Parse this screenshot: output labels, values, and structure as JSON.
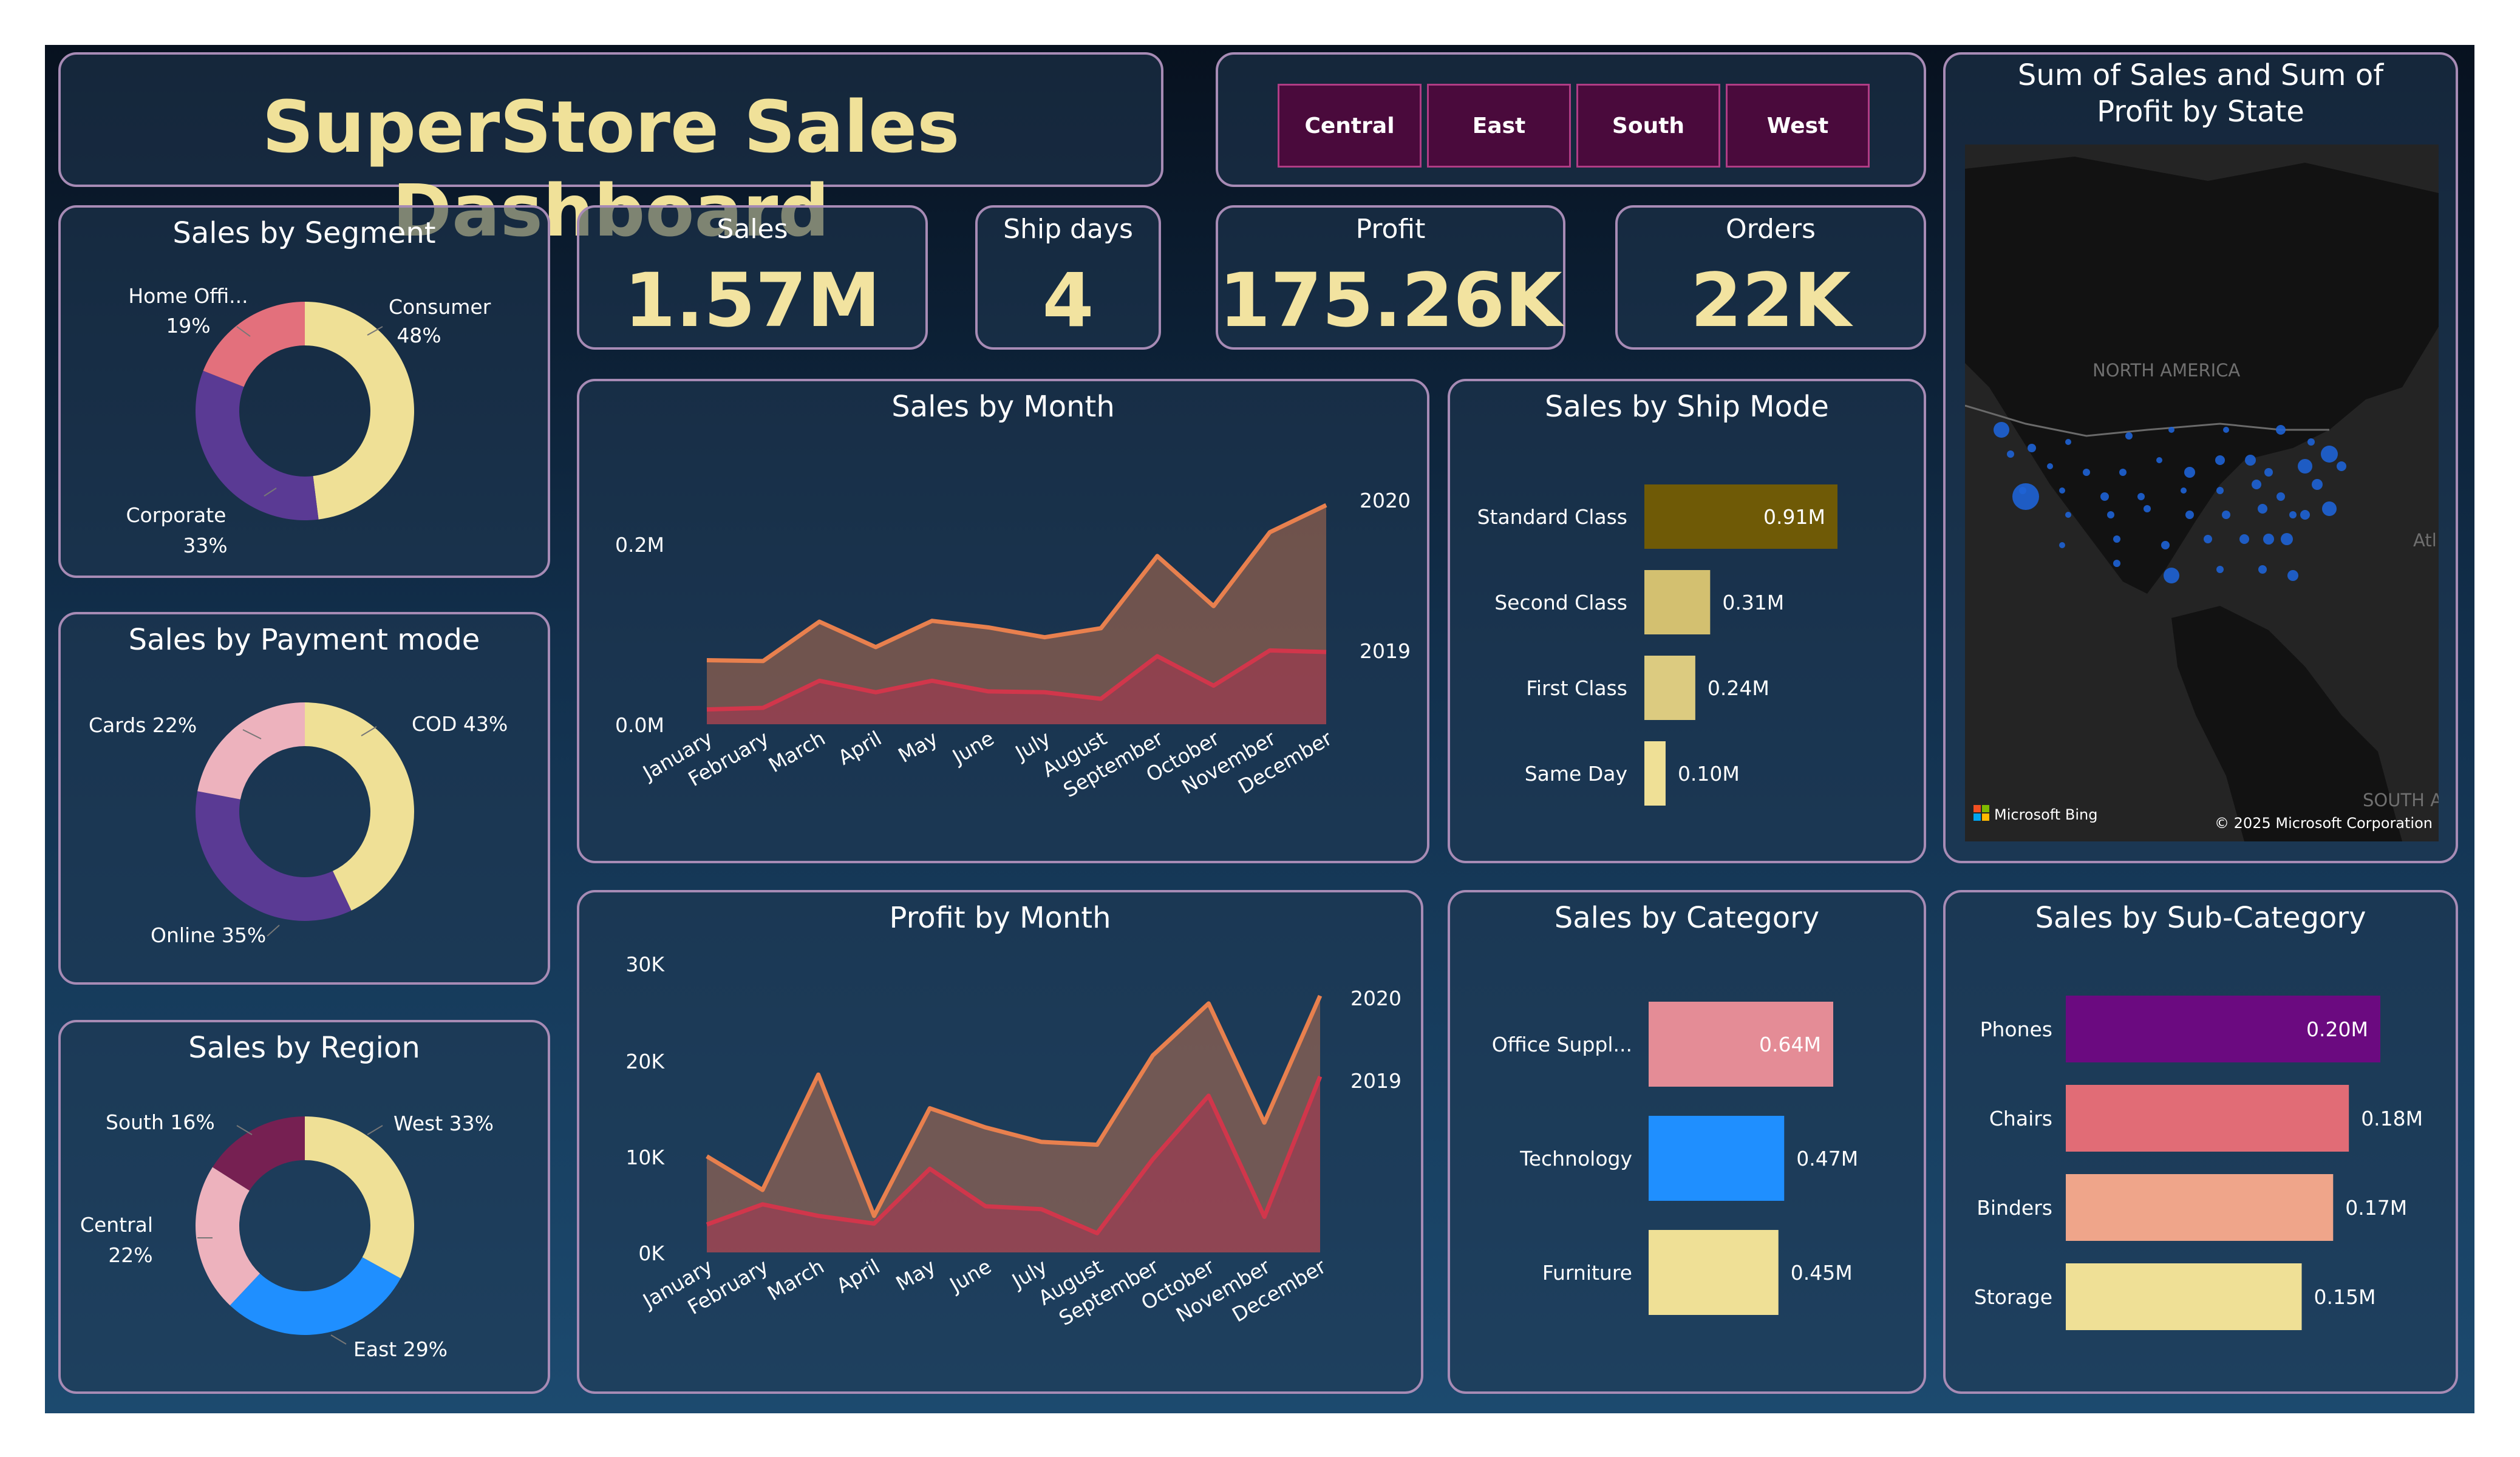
{
  "title": "SuperStore Sales Dashboard",
  "slicers": [
    "Central",
    "East",
    "South",
    "West"
  ],
  "kpis": {
    "sales": {
      "label": "Sales",
      "value": "1.57M"
    },
    "ship_days": {
      "label": "Ship days",
      "value": "4"
    },
    "profit": {
      "label": "Profit",
      "value": "175.26K"
    },
    "orders": {
      "label": "Orders",
      "value": "22K"
    }
  },
  "segment": {
    "title": "Sales by Segment",
    "labels": {
      "home_office": "Home Offi...",
      "home_office_pct": "19%",
      "consumer": "Consumer",
      "consumer_pct": "48%",
      "corporate": "Corporate",
      "corporate_pct": "33%"
    },
    "chart_data": {
      "type": "pie",
      "slices": [
        {
          "name": "Consumer",
          "value": 48,
          "color": "#efe096"
        },
        {
          "name": "Corporate",
          "value": 33,
          "color": "#5a3a94"
        },
        {
          "name": "Home Office",
          "value": 19,
          "color": "#e3707c"
        }
      ]
    }
  },
  "payment": {
    "title": "Sales by Payment mode",
    "labels": {
      "cod": "COD 43%",
      "online": "Online 35%",
      "cards": "Cards 22%"
    },
    "chart_data": {
      "type": "pie",
      "slices": [
        {
          "name": "COD",
          "value": 43,
          "color": "#efe096"
        },
        {
          "name": "Online",
          "value": 35,
          "color": "#5a3a94"
        },
        {
          "name": "Cards",
          "value": 22,
          "color": "#edb2bd"
        }
      ]
    }
  },
  "region": {
    "title": "Sales by Region",
    "labels": {
      "west": "West 33%",
      "east": "East 29%",
      "central": "Central",
      "central_pct": "22%",
      "south": "South 16%"
    },
    "chart_data": {
      "type": "pie",
      "slices": [
        {
          "name": "West",
          "value": 33,
          "color": "#efe096"
        },
        {
          "name": "East",
          "value": 29,
          "color": "#1f8fff"
        },
        {
          "name": "Central",
          "value": 22,
          "color": "#edb2bd"
        },
        {
          "name": "South",
          "value": 16,
          "color": "#762052"
        }
      ]
    }
  },
  "sales_month": {
    "title": "Sales by Month",
    "chart_data": {
      "type": "area",
      "categories": [
        "January",
        "February",
        "March",
        "April",
        "May",
        "June",
        "July",
        "August",
        "September",
        "October",
        "November",
        "December"
      ],
      "series": [
        {
          "name": "2020",
          "values": [
            0.078,
            0.077,
            0.125,
            0.094,
            0.126,
            0.118,
            0.106,
            0.117,
            0.205,
            0.144,
            0.234,
            0.267
          ],
          "color": "#e8804e"
        },
        {
          "name": "2019",
          "values": [
            0.018,
            0.02,
            0.053,
            0.039,
            0.053,
            0.04,
            0.039,
            0.031,
            0.083,
            0.047,
            0.09,
            0.088
          ],
          "color": "#d1364b"
        }
      ],
      "ytick_labels": [
        "0.2M",
        "0.0M"
      ],
      "ylim": [
        0,
        0.27
      ]
    }
  },
  "profit_month": {
    "title": "Profit by Month",
    "chart_data": {
      "type": "area",
      "categories": [
        "January",
        "February",
        "March",
        "April",
        "May",
        "June",
        "July",
        "August",
        "September",
        "October",
        "November",
        "December"
      ],
      "series": [
        {
          "name": "2020",
          "values": [
            10000,
            6500,
            18500,
            3800,
            15000,
            13000,
            11500,
            11200,
            20500,
            25900,
            13500,
            26700
          ],
          "color": "#e8804e"
        },
        {
          "name": "2019",
          "values": [
            2900,
            5000,
            3800,
            3000,
            8700,
            4800,
            4500,
            2000,
            9700,
            16300,
            3700,
            18300
          ],
          "color": "#d1364b"
        }
      ],
      "ytick_labels": [
        "30K",
        "20K",
        "10K",
        "0K"
      ],
      "ylim": [
        0,
        30000
      ]
    }
  },
  "ship_mode": {
    "title": "Sales by Ship Mode",
    "chart_data": {
      "type": "bar",
      "categories": [
        "Standard Class",
        "Second Class",
        "First Class",
        "Same Day"
      ],
      "values": [
        0.91,
        0.31,
        0.24,
        0.1
      ],
      "value_labels": [
        "0.91M",
        "0.31M",
        "0.24M",
        "0.10M"
      ],
      "colors": [
        "#6f5a06",
        "#d3c070",
        "#dccb80",
        "#efe096"
      ]
    }
  },
  "category": {
    "title": "Sales by Category",
    "chart_data": {
      "type": "bar",
      "categories": [
        "Office Suppl...",
        "Technology",
        "Furniture"
      ],
      "values": [
        0.64,
        0.47,
        0.45
      ],
      "value_labels": [
        "0.64M",
        "0.47M",
        "0.45M"
      ],
      "colors": [
        "#e48c96",
        "#1f8fff",
        "#efe096"
      ]
    }
  },
  "sub_category": {
    "title": "Sales by Sub-Category",
    "chart_data": {
      "type": "bar",
      "categories": [
        "Phones",
        "Chairs",
        "Binders",
        "Storage"
      ],
      "values": [
        0.2,
        0.18,
        0.17,
        0.15
      ],
      "value_labels": [
        "0.20M",
        "0.18M",
        "0.17M",
        "0.15M"
      ],
      "colors": [
        "#6b0a80",
        "#e16c76",
        "#efa58a",
        "#efe096"
      ]
    }
  },
  "map": {
    "title": "Sum of Sales and Sum of Profit by State",
    "labels": {
      "na": "NORTH AMERICA",
      "atlantic": "Atl",
      "south": "SOUTH A",
      "bing": "Microsoft Bing",
      "copyright": "© 2025 Microsoft Corporation"
    },
    "bubble_color": "#1e63d6"
  }
}
